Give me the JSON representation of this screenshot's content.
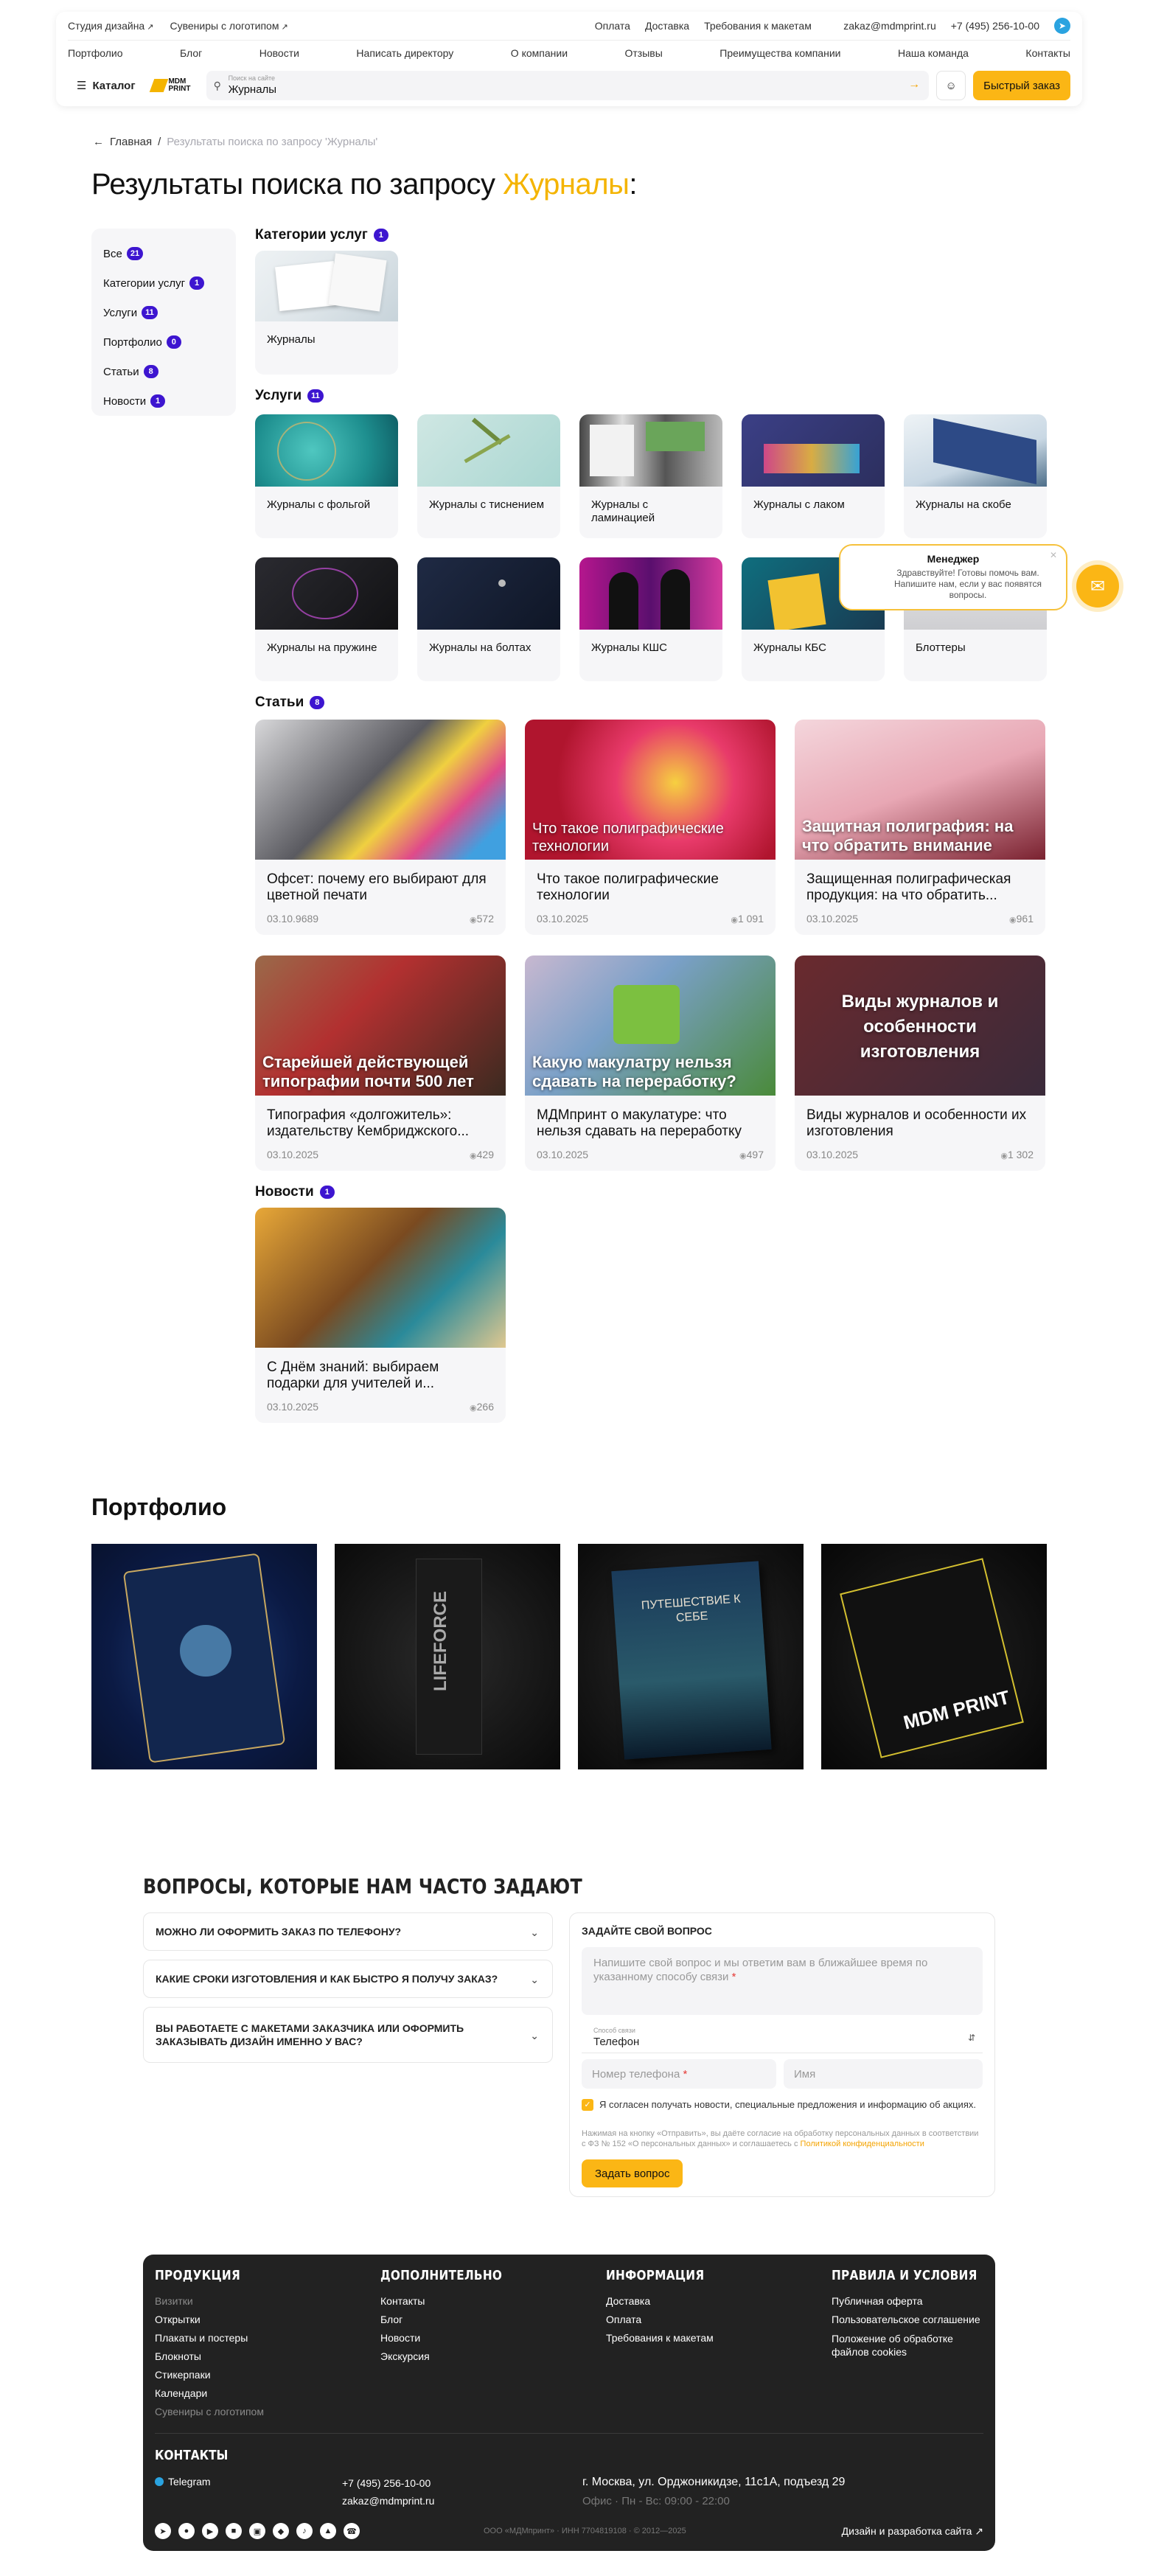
{
  "header": {
    "top_left": [
      "Студия дизайна",
      "Сувениры с логотипом"
    ],
    "top_mid": [
      "Оплата",
      "Доставка",
      "Требования к макетам"
    ],
    "email": "zakaz@mdmprint.ru",
    "phone": "+7 (495) 256-10-00",
    "nav": [
      "Портфолио",
      "Блог",
      "Новости",
      "Написать директору",
      "О компании",
      "Отзывы",
      "Преимущества компании",
      "Наша команда",
      "Контакты"
    ],
    "catalog": "Каталог",
    "logo_text": "MDM PRINT",
    "search_label": "Поиск на сайте",
    "search_value": "Журналы",
    "quick_order": "Быстрый заказ"
  },
  "breadcrumb": {
    "home": "Главная",
    "current": "Результаты поиска по запросу 'Журналы'"
  },
  "title": {
    "prefix": "Результаты поиска по запросу ",
    "query": "Журналы",
    "suffix": ":"
  },
  "filters": [
    {
      "label": "Все",
      "count": "21"
    },
    {
      "label": "Категории услуг",
      "count": "1"
    },
    {
      "label": "Услуги",
      "count": "11"
    },
    {
      "label": "Портфолио",
      "count": "0"
    },
    {
      "label": "Статьи",
      "count": "8"
    },
    {
      "label": "Новости",
      "count": "1"
    }
  ],
  "categories": {
    "title": "Категории услуг",
    "count": "1",
    "items": [
      {
        "title": "Журналы"
      }
    ]
  },
  "services": {
    "title": "Услуги",
    "count": "11",
    "items": [
      {
        "title": "Журналы с фольгой"
      },
      {
        "title": "Журналы с тиснением"
      },
      {
        "title": "Журналы с ламинацией"
      },
      {
        "title": "Журналы с лаком"
      },
      {
        "title": "Журналы на скобе"
      },
      {
        "title": "Журналы на пружине"
      },
      {
        "title": "Журналы на болтах"
      },
      {
        "title": "Журналы КШС"
      },
      {
        "title": "Журналы КБС"
      },
      {
        "title": "Блоттеры"
      }
    ]
  },
  "articles": {
    "title": "Статьи",
    "count": "8",
    "items": [
      {
        "title": "Офсет: почему его выбирают для цветной печати",
        "date": "03.10.9689",
        "views": "572",
        "overlay": ""
      },
      {
        "title": "Что такое полиграфические технологии",
        "date": "03.10.2025",
        "views": "1 091",
        "overlay": "Что такое полиграфические технологии"
      },
      {
        "title": "Защищенная полиграфическая продукция: на что обратить...",
        "date": "03.10.2025",
        "views": "961",
        "overlay": "Защитная полиграфия: на что обратить внимание"
      },
      {
        "title": "Типография «долгожитель»: издательству Кембриджского...",
        "date": "03.10.2025",
        "views": "429",
        "overlay": "Старейшей действующей типографии почти 500 лет"
      },
      {
        "title": "МДМпринт о макулатуре: что нельзя сдавать на переработку",
        "date": "03.10.2025",
        "views": "497",
        "overlay": "Какую макулатру нельзя сдавать на переработку?"
      },
      {
        "title": "Виды журналов и особенности их изготовления",
        "date": "03.10.2025",
        "views": "1 302",
        "overlay": "Виды журналов и особенности изготовления"
      }
    ]
  },
  "news": {
    "title": "Новости",
    "count": "1",
    "items": [
      {
        "title": "С Днём знаний: выбираем подарки для учителей и...",
        "date": "03.10.2025",
        "views": "266"
      }
    ]
  },
  "chat": {
    "title": "Менеджер",
    "message": "Здравствуйте! Готовы помочь вам. Напишите нам, если у вас появятся вопросы."
  },
  "portfolio": {
    "title": "Портфолио",
    "items": [
      {
        "text": ""
      },
      {
        "text": "LIFEFORCE"
      },
      {
        "text": "ПУТЕШЕСТВИЕ К СЕБЕ"
      },
      {
        "text": "MDM PRINT"
      }
    ]
  },
  "faq": {
    "title": "Вопросы, которые нам часто задают",
    "items": [
      "Можно ли оформить заказ по телефону?",
      "Какие сроки изготовления и как быстро я получу заказ?",
      "Вы работаете с макетами заказчика или оформить заказывать дизайн именно у вас?"
    ],
    "form": {
      "title": "Задайте свой вопрос",
      "question_placeholder": "Напишите свой вопрос и мы ответим вам в ближайшее время по указанному способу связи",
      "contact_label": "Способ связи",
      "contact_value": "Телефон",
      "phone_placeholder": "Номер телефона",
      "name_placeholder": "Имя",
      "consent": "Я согласен получать новости, специальные предложения и информацию об акциях.",
      "legal": "Нажимая на кнопку «Отправить», вы даёте согласие на обработку персональных данных в соответствии с ФЗ № 152 «О персональных данных» и соглашаетесь с",
      "legal_link": "Политикой конфиденциальности",
      "submit": "Задать вопрос"
    }
  },
  "footer": {
    "products": {
      "title": "Продукция",
      "items": [
        "Визитки",
        "Открытки",
        "Плакаты и постеры",
        "Блокноты",
        "Стикерпаки",
        "Календари",
        "Сувениры с логотипом"
      ]
    },
    "extra": {
      "title": "Дополнительно",
      "items": [
        "Контакты",
        "Блог",
        "Новости",
        "Экскурсия"
      ]
    },
    "info": {
      "title": "Информация",
      "items": [
        "Доставка",
        "Оплата",
        "Требования к макетам"
      ]
    },
    "rules": {
      "title": "Правила и условия",
      "items": [
        "Публичная оферта",
        "Пользовательское соглашение",
        "Положение об обработке файлов cookies"
      ]
    },
    "contacts_title": "Контакты",
    "telegram": "Telegram",
    "phone": "+7 (495) 256-10-00",
    "email": "zakaz@mdmprint.ru",
    "address": "г. Москва, ул. Орджоникидзе, 11с1А, подъезд 29",
    "hours": "Офис · Пн - Вс: 09:00 - 22:00",
    "copyright": "ООО «МДМпринт» · ИНН 7704819108 · © 2012—2025",
    "dev": "Дизайн и разработка сайта"
  }
}
